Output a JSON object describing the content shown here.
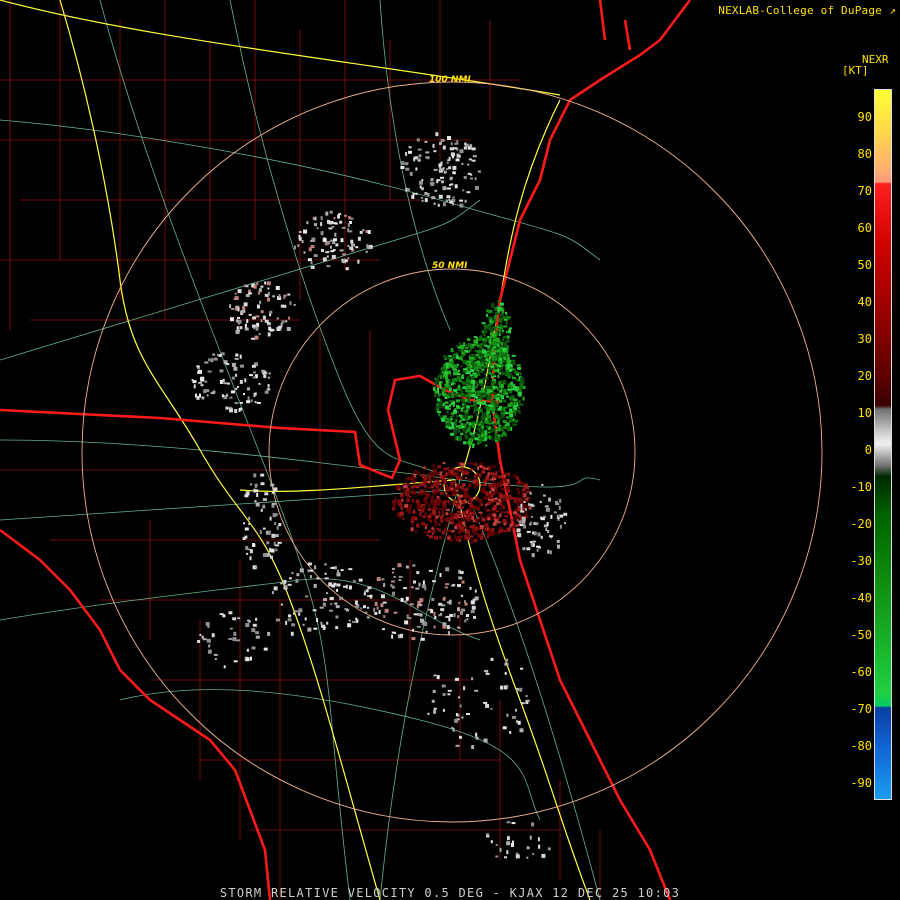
{
  "credit": {
    "text": "NEXLAB-College of DuPage",
    "icon": "external-link-icon"
  },
  "legend": {
    "title": "NEXR",
    "unit": "[KT]",
    "ticks": [
      "90",
      "80",
      "70",
      "60",
      "50",
      "40",
      "30",
      "20",
      "10",
      "0",
      "-10",
      "-20",
      "-30",
      "-40",
      "-50",
      "-60",
      "-70",
      "-80",
      "-90"
    ]
  },
  "range_rings": {
    "inner": "50 NMI",
    "outer": "100 NMI"
  },
  "caption": "STORM RELATIVE VELOCITY 0.5 DEG - KJAX 12 DEC 25 10:03",
  "colors": {
    "state_lines": "#ff1a1a",
    "counties": "#b01010",
    "highways": "#ffff40",
    "roads": "#7fe0b0",
    "rings": "#f0b090"
  }
}
